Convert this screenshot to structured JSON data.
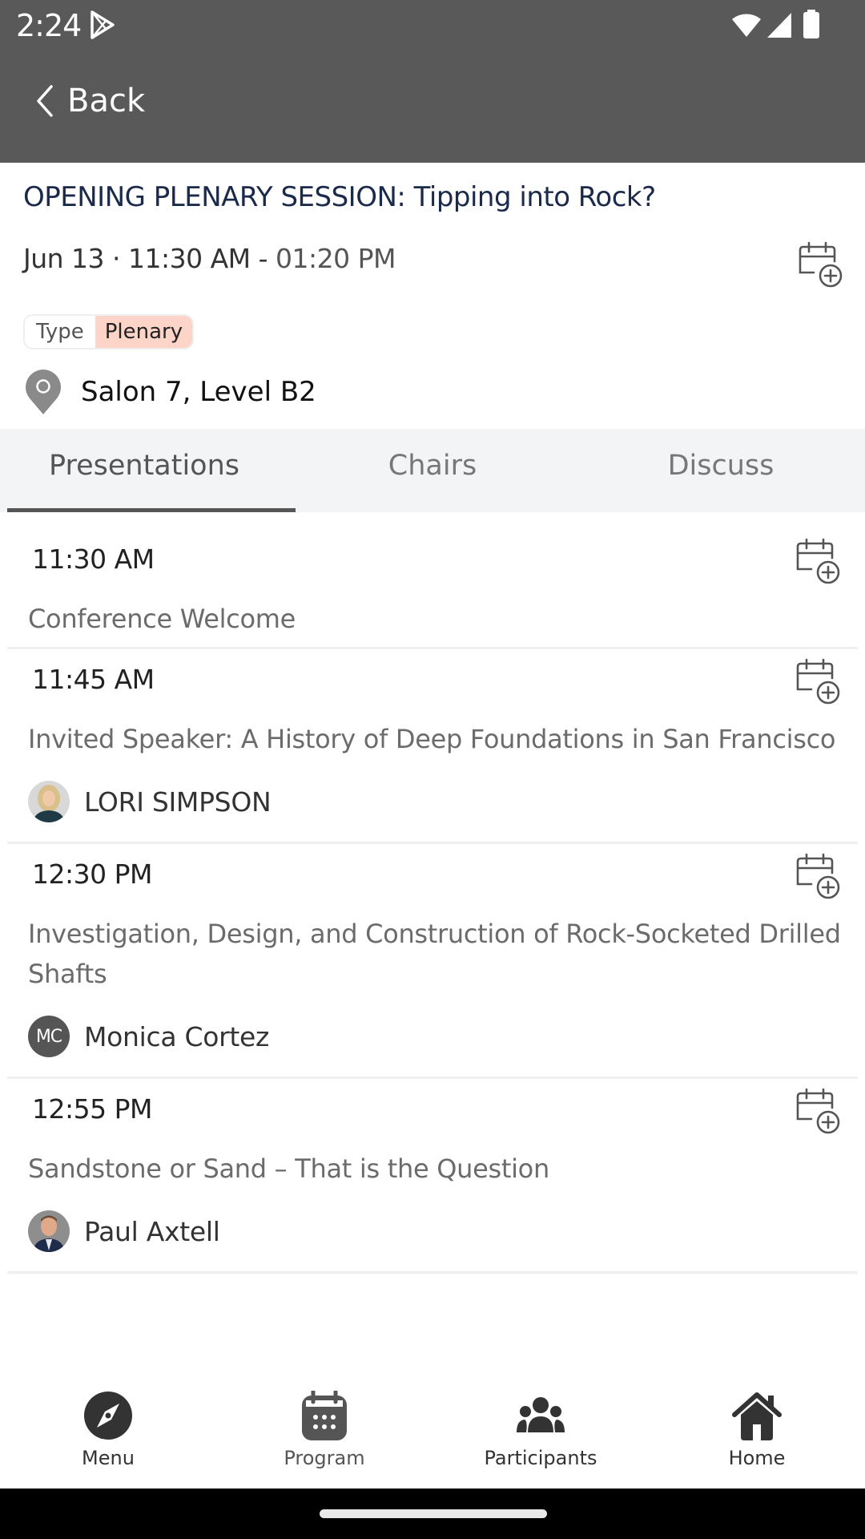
{
  "status_bar": {
    "time": "2:24",
    "icons": [
      "play-store-icon",
      "wifi-icon",
      "signal-icon",
      "battery-icon"
    ]
  },
  "header": {
    "back_label": "Back"
  },
  "session": {
    "title": "OPENING PLENARY SESSION: Tipping into Rock?",
    "date_start": "Jun 13 · 11:30 AM -",
    "end_time": " 01:20 PM",
    "type_key": "Type",
    "type_value": "Plenary",
    "type_color": "#fdd5c8",
    "location": "Salon 7, Level B2"
  },
  "tabs": [
    {
      "label": "Presentations",
      "active": true
    },
    {
      "label": "Chairs",
      "active": false
    },
    {
      "label": "Discuss",
      "active": false
    }
  ],
  "presentations": [
    {
      "time": "11:30 AM",
      "title": "Conference Welcome",
      "speaker": null
    },
    {
      "time": "11:45 AM",
      "title": "Invited Speaker: A History of Deep Foundations in San Francisco",
      "speaker": {
        "name": "LORI SIMPSON",
        "avatar": "photo"
      }
    },
    {
      "time": "12:30 PM",
      "title": "Investigation, Design, and Construction of Rock-Socketed Drilled Shafts",
      "speaker": {
        "name": "Monica Cortez",
        "avatar": "initials",
        "initials": "MC"
      }
    },
    {
      "time": "12:55 PM",
      "title": "Sandstone or Sand – That is the Question",
      "speaker": {
        "name": "Paul Axtell",
        "avatar": "photo"
      }
    }
  ],
  "bottom_nav": [
    {
      "label": "Menu",
      "icon": "compass-icon"
    },
    {
      "label": "Program",
      "icon": "calendar-icon"
    },
    {
      "label": "Participants",
      "icon": "people-icon"
    },
    {
      "label": "Home",
      "icon": "home-icon"
    }
  ],
  "colors": {
    "header_bg": "#595959",
    "title_color": "#1b2a4a",
    "tab_bg": "#f3f4f5",
    "tab_indicator": "#555555"
  }
}
